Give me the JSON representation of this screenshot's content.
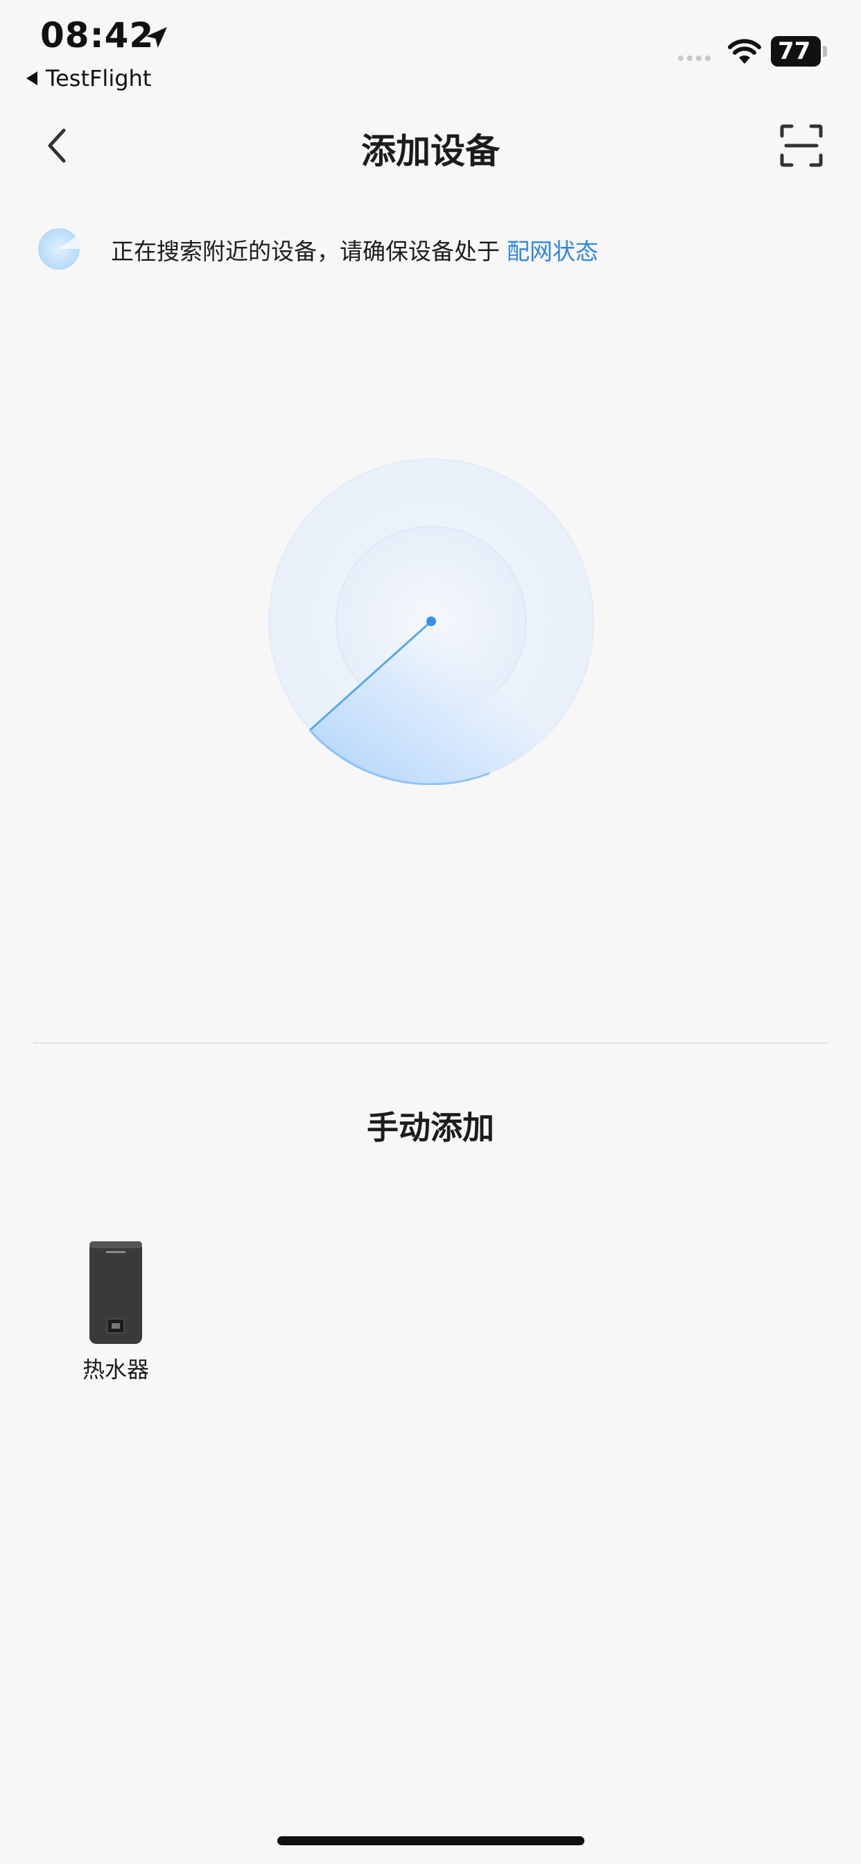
{
  "status_bar": {
    "time": "08:42",
    "back_app": "TestFlight",
    "battery": "77"
  },
  "nav": {
    "title": "添加设备"
  },
  "search": {
    "text": "正在搜索附近的设备，请确保设备处于",
    "link": "配网状态"
  },
  "manual": {
    "title": "手动添加",
    "devices": [
      {
        "label": "热水器"
      }
    ]
  },
  "colors": {
    "accent": "#2f86e0",
    "background": "#f7f7f7"
  }
}
